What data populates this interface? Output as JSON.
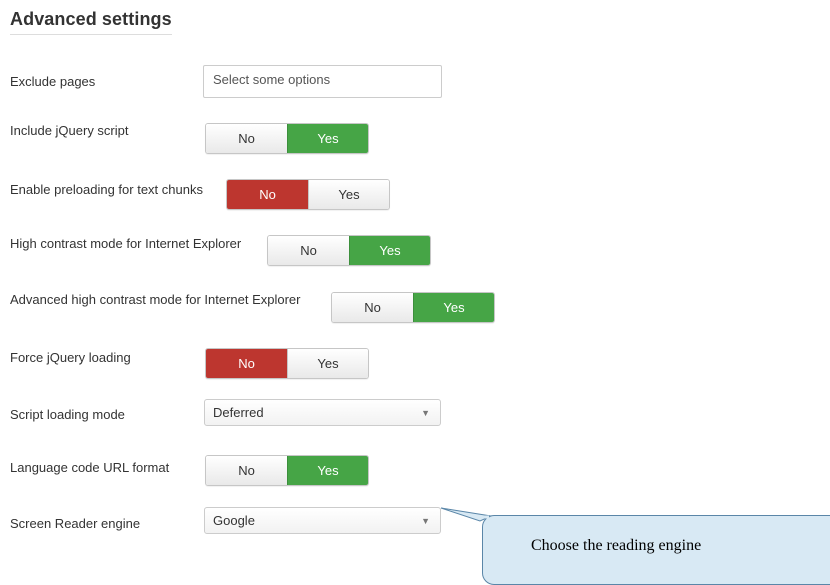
{
  "section": {
    "title": "Advanced settings"
  },
  "fields": {
    "exclude_pages": {
      "label": "Exclude pages",
      "placeholder": "Select some options"
    },
    "include_jquery": {
      "label": "Include jQuery script",
      "no": "No",
      "yes": "Yes",
      "selected": "Yes"
    },
    "preload_text": {
      "label": "Enable preloading for text chunks",
      "no": "No",
      "yes": "Yes",
      "selected": "No"
    },
    "high_contrast_ie": {
      "label": "High contrast mode for Internet Explorer",
      "no": "No",
      "yes": "Yes",
      "selected": "Yes"
    },
    "adv_high_contrast_ie": {
      "label": "Advanced high contrast mode for Internet Explorer",
      "no": "No",
      "yes": "Yes",
      "selected": "Yes"
    },
    "force_jquery": {
      "label": "Force jQuery loading",
      "no": "No",
      "yes": "Yes",
      "selected": "No"
    },
    "script_loading_mode": {
      "label": "Script loading mode",
      "value": "Deferred"
    },
    "lang_code_url": {
      "label": "Language code URL format",
      "no": "No",
      "yes": "Yes",
      "selected": "Yes"
    },
    "screen_reader_engine": {
      "label": "Screen Reader engine",
      "value": "Google"
    }
  },
  "callout": {
    "text": "Choose the reading engine"
  },
  "colors": {
    "yes_active": "#46a546",
    "no_active": "#bd362f",
    "callout_bg": "#d8e9f4"
  }
}
